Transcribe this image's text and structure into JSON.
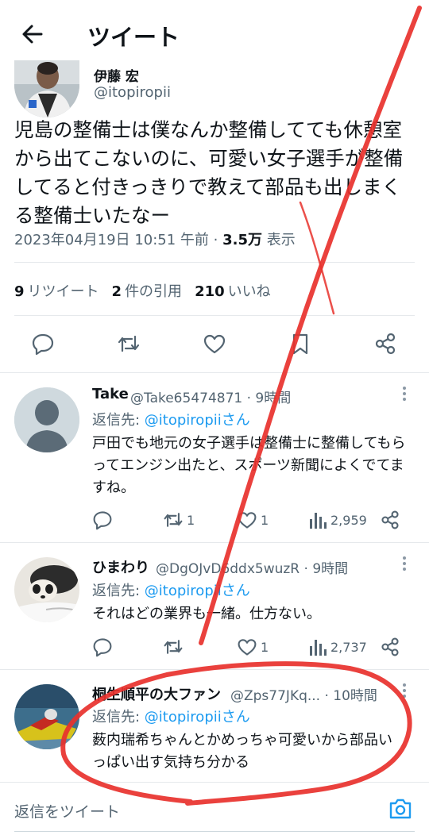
{
  "header": {
    "title": "ツイート"
  },
  "tweet": {
    "author_name": "伊藤 宏",
    "author_handle": "@itopiropii",
    "text": "児島の整備士は僕なんか整備してても休憩室から出てこないのに、可愛い女子選手が整備してると付きっきりで教えて部品も出しまくる整備士いたなー",
    "timestamp": "2023年04月19日 10:51 午前 · ",
    "views_count": "3.5万",
    "views_label": " 表示",
    "retweets_count": "9",
    "retweets_label": "リツイート",
    "quotes_count": "2",
    "quotes_label": "件の引用",
    "likes_count": "210",
    "likes_label": "いいね"
  },
  "replies": [
    {
      "name": "Take",
      "handle_time": "@Take65474871 · 9時間",
      "reply_prefix": "返信先: ",
      "reply_mention": "@itopiropiiさん",
      "text": "戸田でも地元の女子選手は整備士に整備してもらってエンジン出たと、スポーツ新聞によくでてますね。",
      "retweets": "1",
      "likes": "1",
      "views": "2,959"
    },
    {
      "name": "ひまわり",
      "handle_time": "@DgOJvD6ddx5wuzR · 9時間",
      "reply_prefix": "返信先: ",
      "reply_mention": "@itopiropiiさん",
      "text": "それはどの業界も一緒。仕方ない。",
      "retweets": "",
      "likes": "1",
      "views": "2,737"
    },
    {
      "name": "桐生順平の大ファン",
      "handle_time": "@Zps77JKq... · 10時間",
      "reply_prefix": "返信先: ",
      "reply_mention": "@itopiropiiさん",
      "text": "薮内瑞希ちゃんとかめっちゃ可愛いから部品いっぱい出す気持ち分かる"
    }
  ],
  "reply_bar": {
    "placeholder": "返信をツイート"
  },
  "colors": {
    "accent": "#1d9bf0",
    "text_primary": "#0f1419",
    "text_secondary": "#536471",
    "annotation": "#e8312c"
  },
  "icons": {
    "back": "arrow-left-icon",
    "reply": "speech-bubble-icon",
    "retweet": "retweet-icon",
    "like": "heart-icon",
    "bookmark": "bookmark-icon",
    "share": "share-icon",
    "views": "bar-chart-icon",
    "more": "more-vertical-icon",
    "camera": "camera-icon"
  }
}
